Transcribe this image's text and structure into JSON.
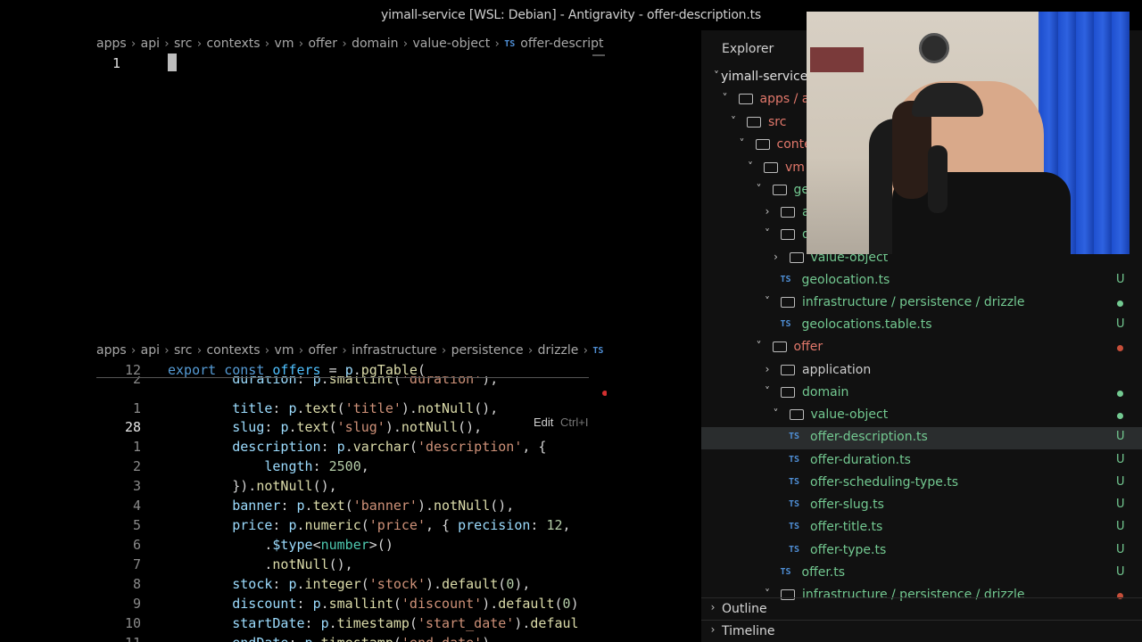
{
  "window": {
    "title": "yimall-service [WSL: Debian] - Antigravity - offer-description.ts"
  },
  "editor_top": {
    "breadcrumb": [
      "apps",
      "api",
      "src",
      "contexts",
      "vm",
      "offer",
      "domain",
      "value-object"
    ],
    "file_label": "offer-descript",
    "file_badge": "TS",
    "line_number": "1"
  },
  "editor_bottom": {
    "breadcrumb": [
      "apps",
      "api",
      "src",
      "contexts",
      "vm",
      "offer",
      "infrastructure",
      "persistence",
      "drizzle"
    ],
    "file_badge": "TS",
    "edit_hint": {
      "label": "Edit",
      "shortcut": "Ctrl+I"
    },
    "lines": [
      {
        "n": "12",
        "tokens": [
          [
            "kw",
            "export "
          ],
          [
            "kw",
            "const "
          ],
          [
            "var",
            "offers"
          ],
          [
            "punc",
            " = "
          ],
          [
            "prop",
            "p"
          ],
          [
            "punc",
            "."
          ],
          [
            "fn",
            "pgTable"
          ],
          [
            "punc",
            "("
          ]
        ]
      },
      {
        "n": "2",
        "tokens": [
          [
            "punc",
            "        "
          ],
          [
            "prop",
            "duration"
          ],
          [
            "punc",
            ": "
          ],
          [
            "prop",
            "p"
          ],
          [
            "punc",
            "."
          ],
          [
            "fn",
            "smallint"
          ],
          [
            "punc",
            "("
          ],
          [
            "str",
            "'duration'"
          ],
          [
            "punc",
            "),"
          ]
        ]
      },
      {
        "n": "1",
        "tokens": [
          [
            "punc",
            "        "
          ],
          [
            "prop",
            "title"
          ],
          [
            "punc",
            ": "
          ],
          [
            "prop",
            "p"
          ],
          [
            "punc",
            "."
          ],
          [
            "fn",
            "text"
          ],
          [
            "punc",
            "("
          ],
          [
            "str",
            "'title'"
          ],
          [
            "punc",
            ")."
          ],
          [
            "fn",
            "notNull"
          ],
          [
            "punc",
            "(),"
          ]
        ]
      },
      {
        "n": "28",
        "tokens": [
          [
            "punc",
            "        "
          ],
          [
            "prop",
            "slug"
          ],
          [
            "punc",
            ": "
          ],
          [
            "prop",
            "p"
          ],
          [
            "punc",
            "."
          ],
          [
            "fn",
            "text"
          ],
          [
            "punc",
            "("
          ],
          [
            "str",
            "'slug'"
          ],
          [
            "punc",
            ")."
          ],
          [
            "fn",
            "notNull"
          ],
          [
            "punc",
            "(),"
          ]
        ]
      },
      {
        "n": "1",
        "tokens": [
          [
            "punc",
            "        "
          ],
          [
            "prop",
            "description"
          ],
          [
            "punc",
            ": "
          ],
          [
            "prop",
            "p"
          ],
          [
            "punc",
            "."
          ],
          [
            "fn",
            "varchar"
          ],
          [
            "punc",
            "("
          ],
          [
            "str",
            "'description'"
          ],
          [
            "punc",
            ", {"
          ]
        ]
      },
      {
        "n": "2",
        "tokens": [
          [
            "punc",
            "            "
          ],
          [
            "prop",
            "length"
          ],
          [
            "punc",
            ": "
          ],
          [
            "num",
            "2500"
          ],
          [
            "punc",
            ","
          ]
        ]
      },
      {
        "n": "3",
        "tokens": [
          [
            "punc",
            "        })."
          ],
          [
            "fn",
            "notNull"
          ],
          [
            "punc",
            "(),"
          ]
        ]
      },
      {
        "n": "4",
        "tokens": [
          [
            "punc",
            "        "
          ],
          [
            "prop",
            "banner"
          ],
          [
            "punc",
            ": "
          ],
          [
            "prop",
            "p"
          ],
          [
            "punc",
            "."
          ],
          [
            "fn",
            "text"
          ],
          [
            "punc",
            "("
          ],
          [
            "str",
            "'banner'"
          ],
          [
            "punc",
            ")."
          ],
          [
            "fn",
            "notNull"
          ],
          [
            "punc",
            "(),"
          ]
        ]
      },
      {
        "n": "5",
        "tokens": [
          [
            "punc",
            "        "
          ],
          [
            "prop",
            "price"
          ],
          [
            "punc",
            ": "
          ],
          [
            "prop",
            "p"
          ],
          [
            "punc",
            "."
          ],
          [
            "fn",
            "numeric"
          ],
          [
            "punc",
            "("
          ],
          [
            "str",
            "'price'"
          ],
          [
            "punc",
            ", { "
          ],
          [
            "prop",
            "precision"
          ],
          [
            "punc",
            ": "
          ],
          [
            "num",
            "12"
          ],
          [
            "punc",
            ","
          ]
        ]
      },
      {
        "n": "6",
        "tokens": [
          [
            "punc",
            "            ."
          ],
          [
            "prop",
            "$type"
          ],
          [
            "punc",
            "<"
          ],
          [
            "ty",
            "number"
          ],
          [
            "punc",
            ">()"
          ]
        ]
      },
      {
        "n": "7",
        "tokens": [
          [
            "punc",
            "            ."
          ],
          [
            "fn",
            "notNull"
          ],
          [
            "punc",
            "(),"
          ]
        ]
      },
      {
        "n": "8",
        "tokens": [
          [
            "punc",
            "        "
          ],
          [
            "prop",
            "stock"
          ],
          [
            "punc",
            ": "
          ],
          [
            "prop",
            "p"
          ],
          [
            "punc",
            "."
          ],
          [
            "fn",
            "integer"
          ],
          [
            "punc",
            "("
          ],
          [
            "str",
            "'stock'"
          ],
          [
            "punc",
            ")."
          ],
          [
            "fn",
            "default"
          ],
          [
            "punc",
            "("
          ],
          [
            "num",
            "0"
          ],
          [
            "punc",
            "),"
          ]
        ]
      },
      {
        "n": "9",
        "tokens": [
          [
            "punc",
            "        "
          ],
          [
            "prop",
            "discount"
          ],
          [
            "punc",
            ": "
          ],
          [
            "prop",
            "p"
          ],
          [
            "punc",
            "."
          ],
          [
            "fn",
            "smallint"
          ],
          [
            "punc",
            "("
          ],
          [
            "str",
            "'discount'"
          ],
          [
            "punc",
            ")."
          ],
          [
            "fn",
            "default"
          ],
          [
            "punc",
            "("
          ],
          [
            "num",
            "0"
          ],
          [
            "punc",
            ")"
          ]
        ]
      },
      {
        "n": "10",
        "tokens": [
          [
            "punc",
            "        "
          ],
          [
            "prop",
            "startDate"
          ],
          [
            "punc",
            ": "
          ],
          [
            "prop",
            "p"
          ],
          [
            "punc",
            "."
          ],
          [
            "fn",
            "timestamp"
          ],
          [
            "punc",
            "("
          ],
          [
            "str",
            "'start_date'"
          ],
          [
            "punc",
            ")."
          ],
          [
            "fn",
            "defaul"
          ]
        ]
      },
      {
        "n": "11",
        "tokens": [
          [
            "punc",
            "        "
          ],
          [
            "prop",
            "endDate"
          ],
          [
            "punc",
            ": "
          ],
          [
            "prop",
            "p"
          ],
          [
            "punc",
            "."
          ],
          [
            "fn",
            "timestamp"
          ],
          [
            "punc",
            "("
          ],
          [
            "str",
            "'end_date'"
          ],
          [
            "punc",
            ")"
          ]
        ]
      }
    ]
  },
  "explorer": {
    "title": "Explorer",
    "tree": [
      {
        "depth": 0,
        "kind": "root",
        "label": "yimall-service [",
        "open": true
      },
      {
        "depth": 1,
        "kind": "folder",
        "label": "apps / ap",
        "open": true,
        "mod": true
      },
      {
        "depth": 2,
        "kind": "folder",
        "label": "src",
        "open": true,
        "mod": true
      },
      {
        "depth": 3,
        "kind": "folder",
        "label": "conte",
        "open": true,
        "mod": true
      },
      {
        "depth": 4,
        "kind": "folder",
        "label": "vm",
        "open": true,
        "mod": true
      },
      {
        "depth": 5,
        "kind": "folder",
        "label": "geo",
        "open": true,
        "mod": false
      },
      {
        "depth": 6,
        "kind": "folder",
        "label": "ap",
        "open": false,
        "mod": false
      },
      {
        "depth": 6,
        "kind": "folder",
        "label": "do",
        "open": true,
        "mod": false
      },
      {
        "depth": 7,
        "kind": "folder",
        "label": "value-object",
        "open": false,
        "mod": false
      },
      {
        "depth": 7,
        "kind": "file",
        "label": "geolocation.ts",
        "status": "U"
      },
      {
        "depth": 6,
        "kind": "folder",
        "label": "infrastructure / persistence / drizzle",
        "open": true,
        "mod": false,
        "dot": "green"
      },
      {
        "depth": 7,
        "kind": "file",
        "label": "geolocations.table.ts",
        "status": "U"
      },
      {
        "depth": 5,
        "kind": "folder",
        "label": "offer",
        "open": true,
        "mod": true,
        "dot": "red"
      },
      {
        "depth": 6,
        "kind": "folder",
        "label": "application",
        "open": false,
        "plain": true
      },
      {
        "depth": 6,
        "kind": "folder",
        "label": "domain",
        "open": true,
        "mod": false,
        "dot": "green"
      },
      {
        "depth": 7,
        "kind": "folder",
        "label": "value-object",
        "open": true,
        "mod": false,
        "dot": "green"
      },
      {
        "depth": 8,
        "kind": "file",
        "label": "offer-description.ts",
        "status": "U",
        "selected": true
      },
      {
        "depth": 8,
        "kind": "file",
        "label": "offer-duration.ts",
        "status": "U"
      },
      {
        "depth": 8,
        "kind": "file",
        "label": "offer-scheduling-type.ts",
        "status": "U"
      },
      {
        "depth": 8,
        "kind": "file",
        "label": "offer-slug.ts",
        "status": "U"
      },
      {
        "depth": 8,
        "kind": "file",
        "label": "offer-title.ts",
        "status": "U"
      },
      {
        "depth": 8,
        "kind": "file",
        "label": "offer-type.ts",
        "status": "U"
      },
      {
        "depth": 7,
        "kind": "file",
        "label": "offer.ts",
        "status": "U"
      },
      {
        "depth": 6,
        "kind": "folder",
        "label": "infrastructure / persistence / drizzle",
        "open": true,
        "mod": false,
        "dot": "red"
      }
    ],
    "panels": [
      "Outline",
      "Timeline"
    ]
  },
  "colors": {
    "accent_ts": "#4f8fd6",
    "untracked_green": "#73c991",
    "modified_red": "#e2786b"
  }
}
